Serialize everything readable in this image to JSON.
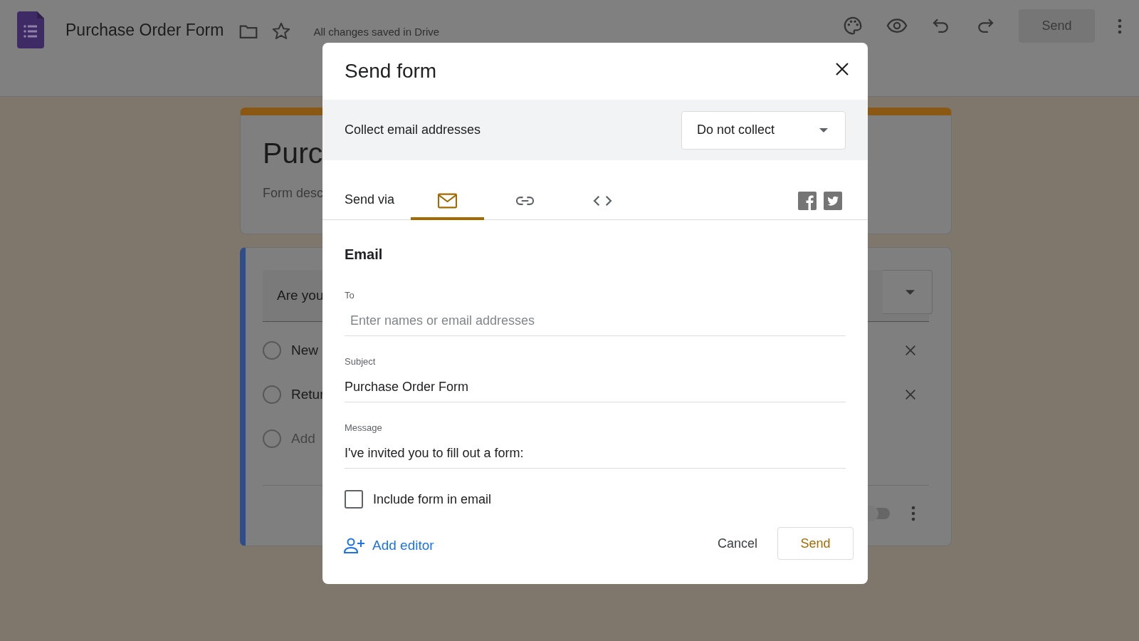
{
  "app": {
    "title": "Purchase Order Form",
    "status": "All changes saved in Drive",
    "send_button": "Send"
  },
  "form_background": {
    "title": "Purc",
    "description": "Form desc",
    "question": "Are you",
    "options": [
      {
        "label": "New",
        "kind": "option"
      },
      {
        "label": "Retur",
        "kind": "option"
      },
      {
        "label": "Add",
        "kind": "add"
      }
    ],
    "required": false
  },
  "dialog": {
    "title": "Send form",
    "collect_label": "Collect email addresses",
    "collect_value": "Do not collect",
    "send_via": "Send via",
    "tabs": [
      {
        "kind": "email",
        "selected": true
      },
      {
        "kind": "link",
        "selected": false
      },
      {
        "kind": "embed",
        "selected": false
      }
    ],
    "section_title": "Email",
    "fields": [
      {
        "label": "To",
        "placeholder": "Enter names or email addresses"
      },
      {
        "label": "Subject",
        "value": "Purchase Order Form"
      },
      {
        "label": "Message",
        "value": "I've invited you to fill out a form:"
      }
    ],
    "include_form": {
      "label": "Include form in email",
      "checked": false
    },
    "add_editor": "Add editor",
    "cancel": "Cancel",
    "send": "Send"
  }
}
